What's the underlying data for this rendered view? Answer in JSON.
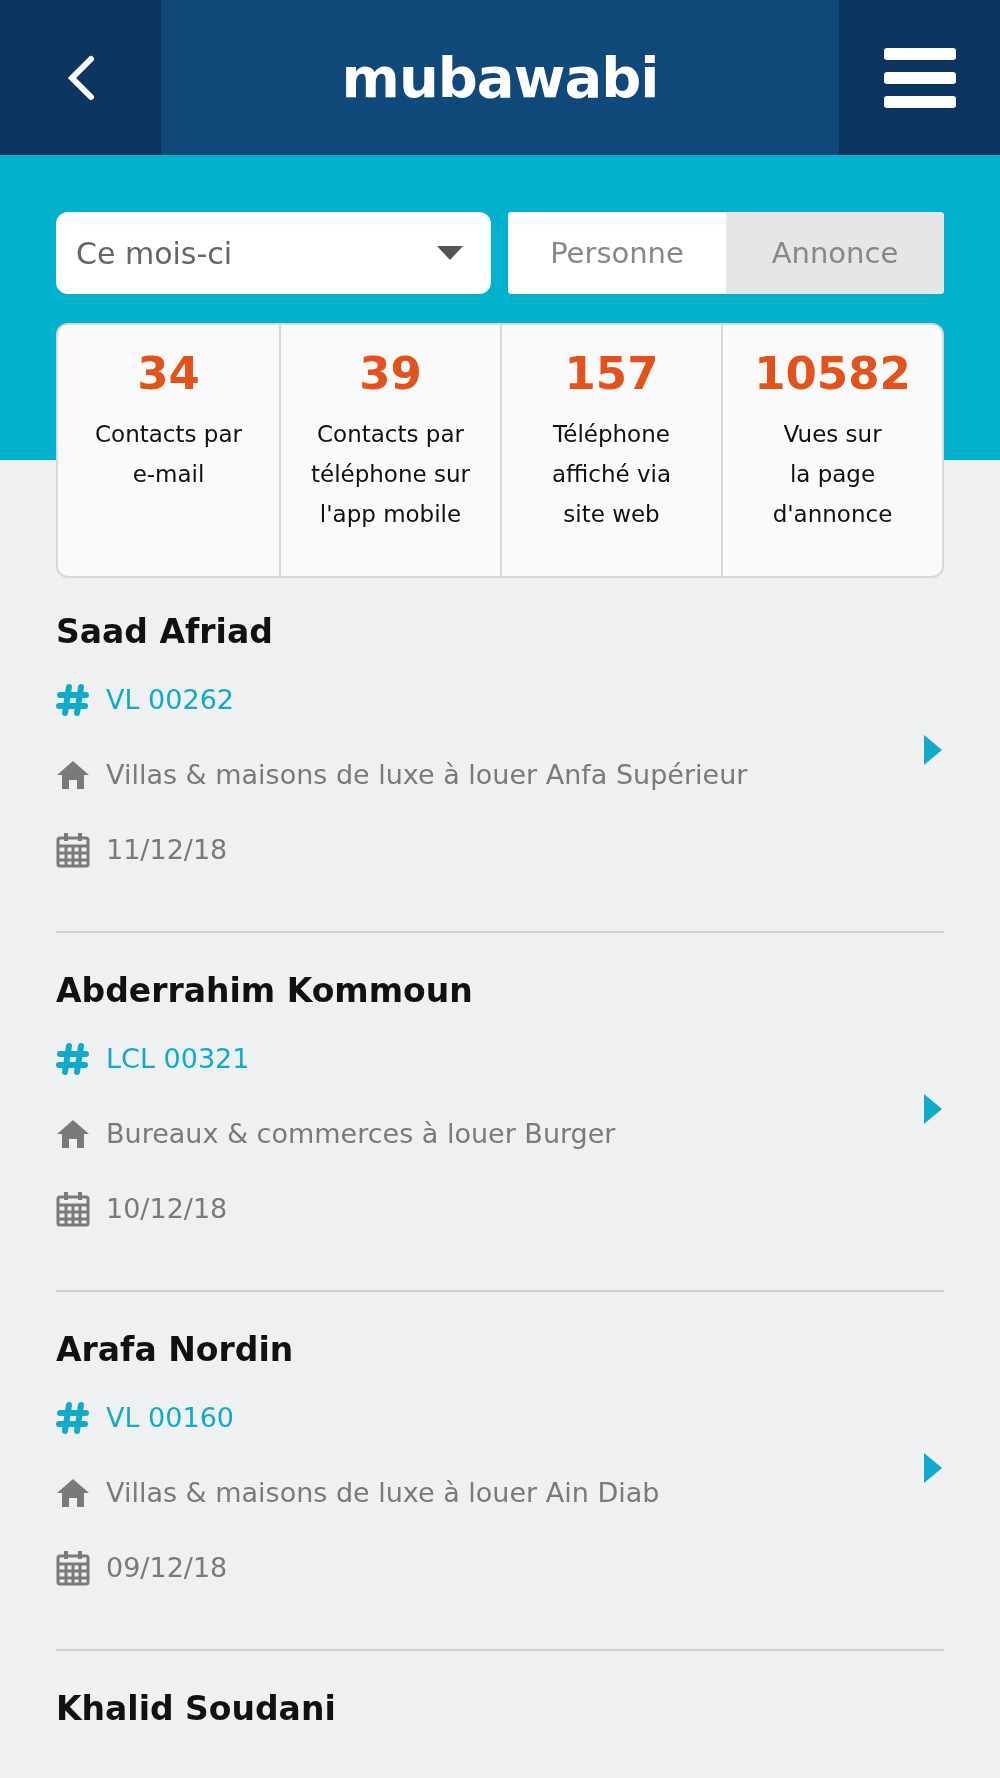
{
  "header": {
    "logo": "mubawabi"
  },
  "filters": {
    "period": "Ce mois-ci",
    "toggle": [
      {
        "label": "Personne",
        "selected": false
      },
      {
        "label": "Annonce",
        "selected": true
      }
    ]
  },
  "stats": [
    {
      "value": "34",
      "label": "Contacts par\ne-mail"
    },
    {
      "value": "39",
      "label": "Contacts par\ntéléphone sur\nl'app mobile"
    },
    {
      "value": "157",
      "label": "Téléphone\naffiché via\nsite web"
    },
    {
      "value": "10582",
      "label": "Vues sur\nla page\nd'annonce"
    }
  ],
  "contacts": [
    {
      "name": "Saad Afriad",
      "reference": "VL 00262",
      "listing": "Villas & maisons de luxe à louer Anfa Supérieur",
      "date": "11/12/18"
    },
    {
      "name": "Abderrahim Kommoun",
      "reference": "LCL 00321",
      "listing": "Bureaux & commerces à louer Burger",
      "date": "10/12/18"
    },
    {
      "name": "Arafa Nordin",
      "reference": "VL 00160",
      "listing": "Villas & maisons de luxe à louer Ain Diab",
      "date": "09/12/18"
    },
    {
      "name": "Khalid Soudani"
    }
  ]
}
